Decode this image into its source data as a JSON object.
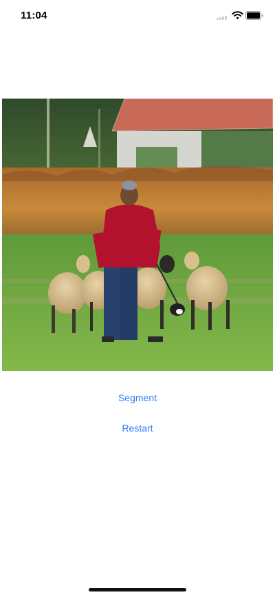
{
  "status_bar": {
    "time": "11:04",
    "icons": [
      "cellular-signal-icon",
      "wifi-icon",
      "battery-icon"
    ]
  },
  "main": {
    "image": {
      "icon": "photo-image",
      "subject": "person in red sweater with dog herding sheep on grass field"
    },
    "segment_label": "Segment",
    "restart_label": "Restart"
  },
  "colors": {
    "accent": "#2f7df6",
    "background": "#ffffff",
    "text": "#000000"
  }
}
